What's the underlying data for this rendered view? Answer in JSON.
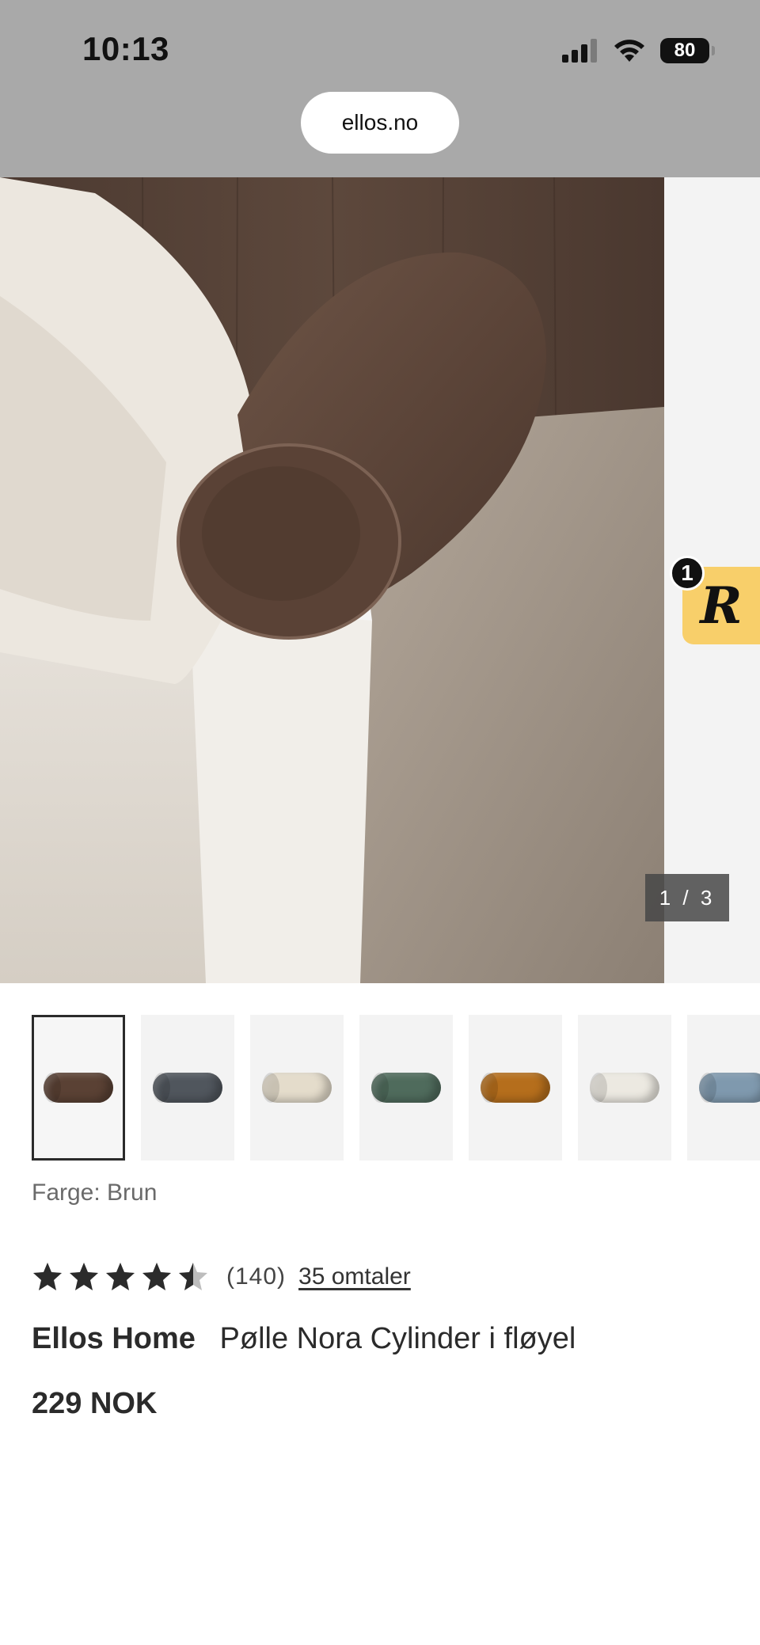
{
  "status_bar": {
    "time": "10:13",
    "battery": "80"
  },
  "browser": {
    "url": "ellos.no"
  },
  "gallery": {
    "counter": "1 / 3",
    "badge_letter": "R",
    "badge_count": "1"
  },
  "thumbnails": [
    {
      "color": "#5a4134",
      "selected": true
    },
    {
      "color": "#50565d",
      "selected": false
    },
    {
      "color": "#e4dccb",
      "selected": false
    },
    {
      "color": "#4f6b5c",
      "selected": false
    },
    {
      "color": "#b56e1c",
      "selected": false
    },
    {
      "color": "#ece9e1",
      "selected": false
    },
    {
      "color": "#7f99ae",
      "selected": false
    }
  ],
  "product": {
    "color_label": "Farge: Brun",
    "rating": 4.5,
    "rating_count": "(140)",
    "reviews_link": "35 omtaler",
    "brand": "Ellos Home",
    "name": "Pølle Nora Cylinder i fløyel",
    "price": "229 NOK"
  },
  "colors": {
    "header_bg": "#a9a9a9",
    "badge_yellow": "#f8cf6a",
    "text_dark": "#2b2b2b"
  }
}
